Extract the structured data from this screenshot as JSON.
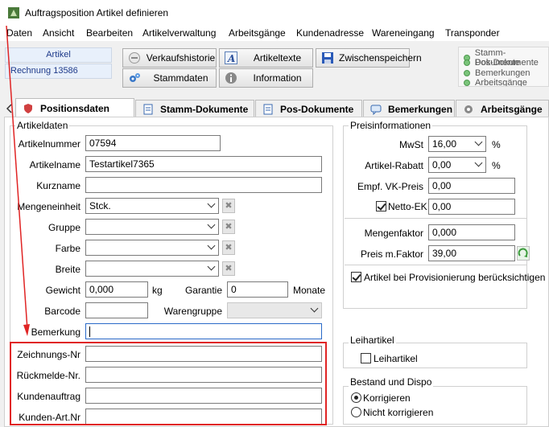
{
  "window": {
    "title": "Auftragsposition Artikel definieren"
  },
  "menu": [
    "Daten",
    "Ansicht",
    "Bearbeiten",
    "Artikelverwaltung",
    "Arbeitsgänge",
    "Kundenadresse",
    "Wareneingang",
    "Transponder"
  ],
  "info": {
    "line1": "Artikel",
    "line2": "Rechnung 13586"
  },
  "toolbar": {
    "verkaufshistorie": "Verkaufshistorie",
    "artikeltexte": "Artikeltexte",
    "zwischenspeichern": "Zwischenspeichern",
    "stammdaten": "Stammdaten",
    "information": "Information"
  },
  "status_items": [
    "Stamm-Dokumente",
    "Pos-Dokumente",
    "Bemerkungen",
    "Arbeitsgänge"
  ],
  "tabs": [
    "Positionsdaten",
    "Stamm-Dokumente",
    "Pos-Dokumente",
    "Bemerkungen",
    "Arbeitsgänge"
  ],
  "artikeldaten": {
    "title": "Artikeldaten",
    "artikelnummer_label": "Artikelnummer",
    "artikelnummer": "07594",
    "artikelname_label": "Artikelname",
    "artikelname": "Testartikel7365",
    "kurzname_label": "Kurzname",
    "kurzname": "",
    "mengeneinheit_label": "Mengeneinheit",
    "mengeneinheit": "Stck.",
    "gruppe_label": "Gruppe",
    "gruppe": "",
    "farbe_label": "Farbe",
    "farbe": "",
    "breite_label": "Breite",
    "breite": "",
    "gewicht_label": "Gewicht",
    "gewicht": "0,000",
    "gewicht_unit": "kg",
    "garantie_label": "Garantie",
    "garantie": "0",
    "garantie_unit": "Monate",
    "barcode_label": "Barcode",
    "barcode": "",
    "warengruppe_label": "Warengruppe",
    "warengruppe": "",
    "bemerkung_label": "Bemerkung",
    "bemerkung": "",
    "zeichnungs_label": "Zeichnungs-Nr",
    "zeichnungs": "",
    "rueckmelde_label": "Rückmelde-Nr.",
    "rueckmelde": "",
    "kundenauftrag_label": "Kundenauftrag",
    "kundenauftrag": "",
    "kundenart_label": "Kunden-Art.Nr",
    "kundenart": ""
  },
  "preis": {
    "title": "Preisinformationen",
    "mwst_label": "MwSt",
    "mwst": "16,00",
    "mwst_unit": "%",
    "rabatt_label": "Artikel-Rabatt",
    "rabatt": "0,00",
    "rabatt_unit": "%",
    "vk_label": "Empf. VK-Preis",
    "vk": "0,00",
    "netto_label": "Netto-EK",
    "netto": "0,00",
    "mengenfaktor_label": "Mengenfaktor",
    "mengenfaktor": "0,000",
    "preis_faktor_label": "Preis m.Faktor",
    "preis_faktor": "39,00",
    "provision_label": "Artikel bei Provisionierung berücksichtigen"
  },
  "leih": {
    "title": "Leihartikel",
    "label": "Leihartikel"
  },
  "bestand": {
    "title": "Bestand und Dispo",
    "korrigieren": "Korrigieren",
    "nicht_korrigieren": "Nicht korrigieren"
  },
  "colors": {
    "accent_red": "#e02424",
    "info_blue": "#1e3a8a",
    "status_green": "#7ac47a"
  }
}
